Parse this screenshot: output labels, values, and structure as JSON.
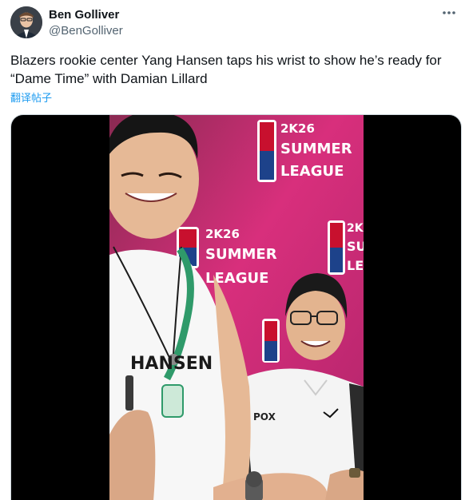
{
  "author": {
    "name": "Ben Golliver",
    "handle": "@BenGolliver"
  },
  "tweet": {
    "text": "Blazers rookie center Yang Hansen taps his wrist to show he’s ready for “Dame Time” with Damian Lillard",
    "translate_label": "翻译帖子"
  },
  "video": {
    "backdrop_text": [
      "2K26",
      "SUMMER",
      "LEAGUE"
    ],
    "shirt_text": "HANSEN",
    "polo_text": "POX"
  },
  "colors": {
    "link": "#1d9bf0",
    "secondary_text": "#536471",
    "backdrop_pink": "#d82f7c"
  }
}
